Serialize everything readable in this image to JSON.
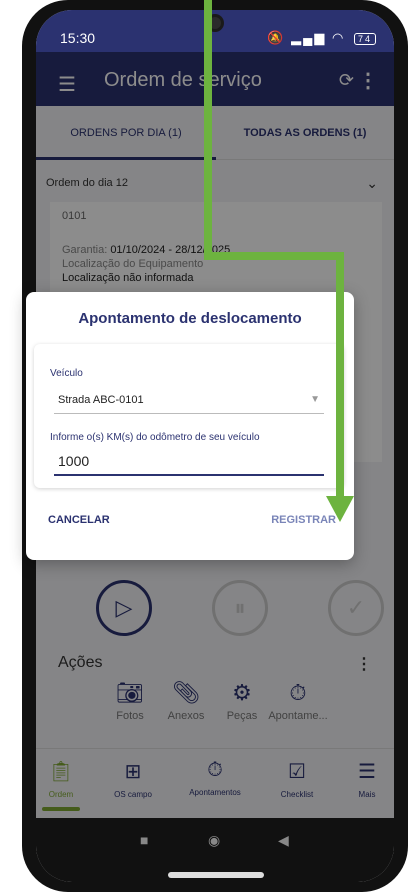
{
  "status_bar": {
    "time": "15:30",
    "battery": "74"
  },
  "app_bar": {
    "title": "Ordem de serviço"
  },
  "tabs": [
    {
      "label": "ORDENS POR DIA (1)"
    },
    {
      "label": "TODAS AS ORDENS (1)"
    }
  ],
  "section": {
    "header": "Ordem do dia 12"
  },
  "card": {
    "code": "0101",
    "garantia_label": "Garantia:",
    "garantia_value": "01/10/2024 - 28/12/2025",
    "localizacao_label": "Localização do Equipamento",
    "localizacao_value": "Localização não informada"
  },
  "dialog": {
    "title": "Apontamento de deslocamento",
    "vehicle_label": "Veículo",
    "vehicle_value": "Strada ABC-0101",
    "odometer_label": "Informe o(s) KM(s) do odômetro de seu veículo",
    "odometer_value": "1000",
    "cancel_label": "CANCELAR",
    "register_label": "REGISTRAR"
  },
  "actions": {
    "title": "Ações",
    "items": [
      {
        "label": "Fotos",
        "icon": "camera-icon"
      },
      {
        "label": "Anexos",
        "icon": "paperclip-icon"
      },
      {
        "label": "Peças",
        "icon": "parts-icon"
      },
      {
        "label": "Apontame...",
        "icon": "stopwatch-icon"
      }
    ]
  },
  "bottom_nav": [
    {
      "label": "Ordem",
      "icon": "clipboard-icon"
    },
    {
      "label": "OS campo",
      "icon": "medical-clipboard-icon"
    },
    {
      "label": "Apontamentos",
      "icon": "stopwatch-icon"
    },
    {
      "label": "Checklist",
      "icon": "checklist-icon"
    },
    {
      "label": "Mais",
      "icon": "hamburger-icon"
    }
  ],
  "colors": {
    "primary": "#2b3270",
    "accent": "#7ea832",
    "overlay_arrow": "#6db33f"
  }
}
